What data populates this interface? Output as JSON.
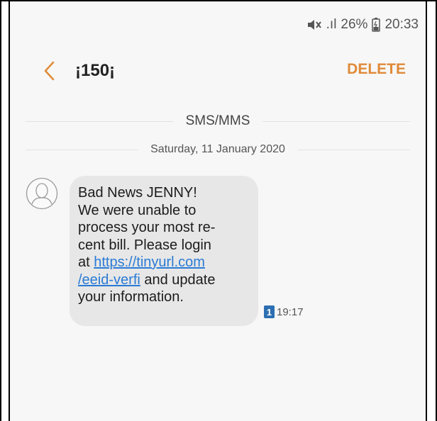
{
  "status_bar": {
    "signal": ".ıl",
    "battery": "26%",
    "time": "20:33"
  },
  "header": {
    "contact": "¡150¡",
    "delete_label": "DELETE"
  },
  "conversation": {
    "channel_label": "SMS/MMS",
    "date_label": "Saturday, 11 January 2020"
  },
  "message": {
    "line1": "Bad News JENNY!",
    "line2": "We were unable to",
    "line3": "process your most re-",
    "line4": "cent bill. Please login",
    "line5_prefix": "at ",
    "link_part1": "https://tinyurl.com",
    "link_part2": "/eeid-verfi",
    "line6_suffix": " and update",
    "line7": "your information.",
    "sim_slot": "1",
    "time": "19:17"
  },
  "colors": {
    "accent": "#e08a38",
    "link": "#2a7bd4",
    "bubble": "#e7e7e7"
  }
}
